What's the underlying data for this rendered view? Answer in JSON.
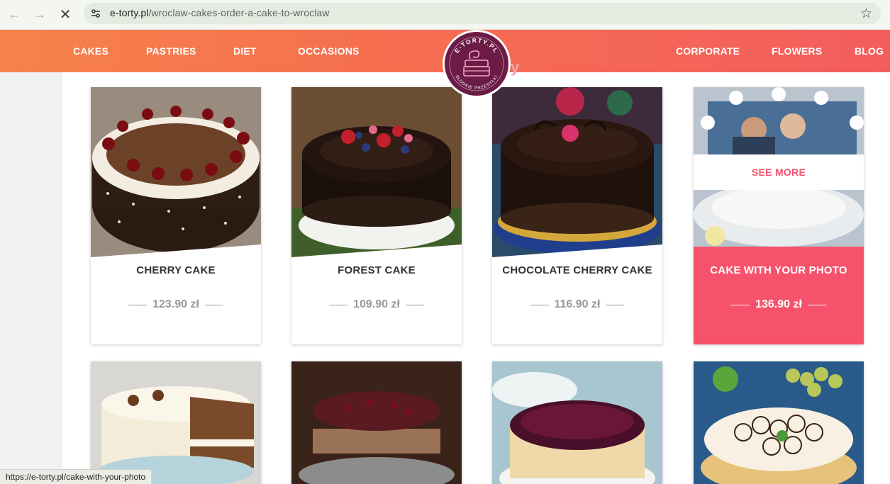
{
  "browser": {
    "url_domain": "e-torty.pl",
    "url_path": "/wroclaw-cakes-order-a-cake-to-wroclaw",
    "status_url": "https://e-torty.pl/cake-with-your-photo"
  },
  "nav": {
    "left": [
      "CAKES",
      "PASTRIES",
      "DIET",
      "OCCASIONS"
    ],
    "right": [
      "CORPORATE",
      "FLOWERS",
      "BLOG"
    ]
  },
  "logo": {
    "top_text": "E-TORTY.PL",
    "bottom_text": "SŁODKIE PRZESYŁKI"
  },
  "products": [
    {
      "title": "CHERRY CAKE",
      "price": "123.90 zł"
    },
    {
      "title": "FOREST CAKE",
      "price": "109.90 zł"
    },
    {
      "title": "CHOCOLATE CHERRY CAKE",
      "price": "116.90 zł"
    },
    {
      "title": "CAKE WITH YOUR PHOTO",
      "price": "136.90 zł",
      "overlay": "SEE MORE"
    }
  ],
  "colors": {
    "header_start": "#f6834b",
    "header_end": "#f35d5d",
    "accent": "#f7526b",
    "logo_bg": "#6b1b45"
  }
}
